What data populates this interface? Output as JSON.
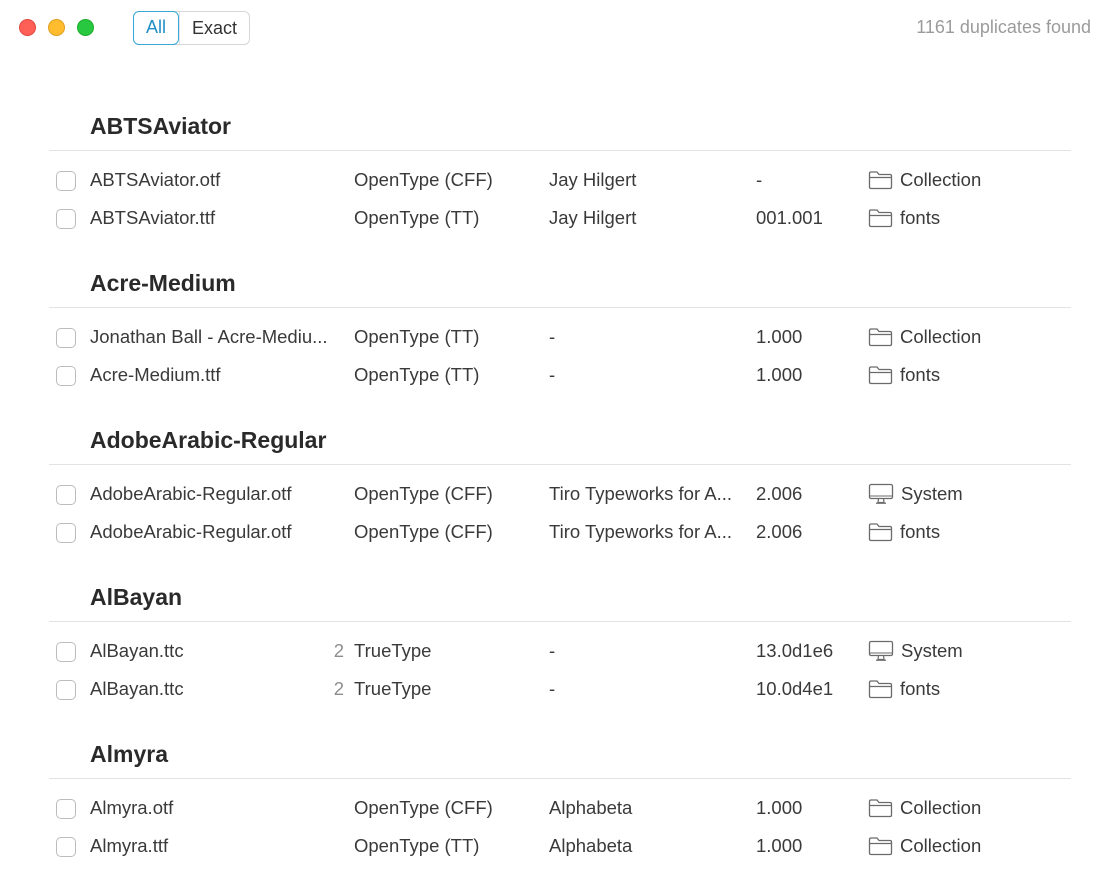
{
  "window": {
    "filter_tabs": [
      {
        "label": "All",
        "active": true
      },
      {
        "label": "Exact",
        "active": false
      }
    ],
    "duplicates_count": "1161 duplicates found"
  },
  "groups": [
    {
      "title": "ABTSAviator",
      "rows": [
        {
          "file": "ABTSAviator.otf",
          "count": "",
          "format": "OpenType (CFF)",
          "designer": "Jay Hilgert",
          "version": "-",
          "location_icon": "folder-icon",
          "location": "Collection"
        },
        {
          "file": "ABTSAviator.ttf",
          "count": "",
          "format": "OpenType (TT)",
          "designer": "Jay Hilgert",
          "version": "001.001",
          "location_icon": "folder-icon",
          "location": "fonts"
        }
      ]
    },
    {
      "title": "Acre-Medium",
      "rows": [
        {
          "file": "Jonathan Ball - Acre-Mediu...",
          "count": "",
          "format": "OpenType (TT)",
          "designer": "-",
          "version": "1.000",
          "location_icon": "folder-icon",
          "location": "Collection"
        },
        {
          "file": "Acre-Medium.ttf",
          "count": "",
          "format": "OpenType (TT)",
          "designer": "-",
          "version": "1.000",
          "location_icon": "folder-icon",
          "location": "fonts"
        }
      ]
    },
    {
      "title": "AdobeArabic-Regular",
      "rows": [
        {
          "file": "AdobeArabic-Regular.otf",
          "count": "",
          "format": "OpenType (CFF)",
          "designer": "Tiro Typeworks for A...",
          "version": "2.006",
          "location_icon": "monitor-icon",
          "location": "System"
        },
        {
          "file": "AdobeArabic-Regular.otf",
          "count": "",
          "format": "OpenType (CFF)",
          "designer": "Tiro Typeworks for A...",
          "version": "2.006",
          "location_icon": "folder-icon",
          "location": "fonts"
        }
      ]
    },
    {
      "title": "AlBayan",
      "rows": [
        {
          "file": "AlBayan.ttc",
          "count": "2",
          "format": "TrueType",
          "designer": "-",
          "version": "13.0d1e6",
          "location_icon": "monitor-icon",
          "location": "System"
        },
        {
          "file": "AlBayan.ttc",
          "count": "2",
          "format": "TrueType",
          "designer": "-",
          "version": "10.0d4e1",
          "location_icon": "folder-icon",
          "location": "fonts"
        }
      ]
    },
    {
      "title": "Almyra",
      "rows": [
        {
          "file": "Almyra.otf",
          "count": "",
          "format": "OpenType (CFF)",
          "designer": "Alphabeta",
          "version": "1.000",
          "location_icon": "folder-icon",
          "location": "Collection"
        },
        {
          "file": "Almyra.ttf",
          "count": "",
          "format": "OpenType (TT)",
          "designer": "Alphabeta",
          "version": "1.000",
          "location_icon": "folder-icon",
          "location": "Collection"
        }
      ]
    }
  ]
}
